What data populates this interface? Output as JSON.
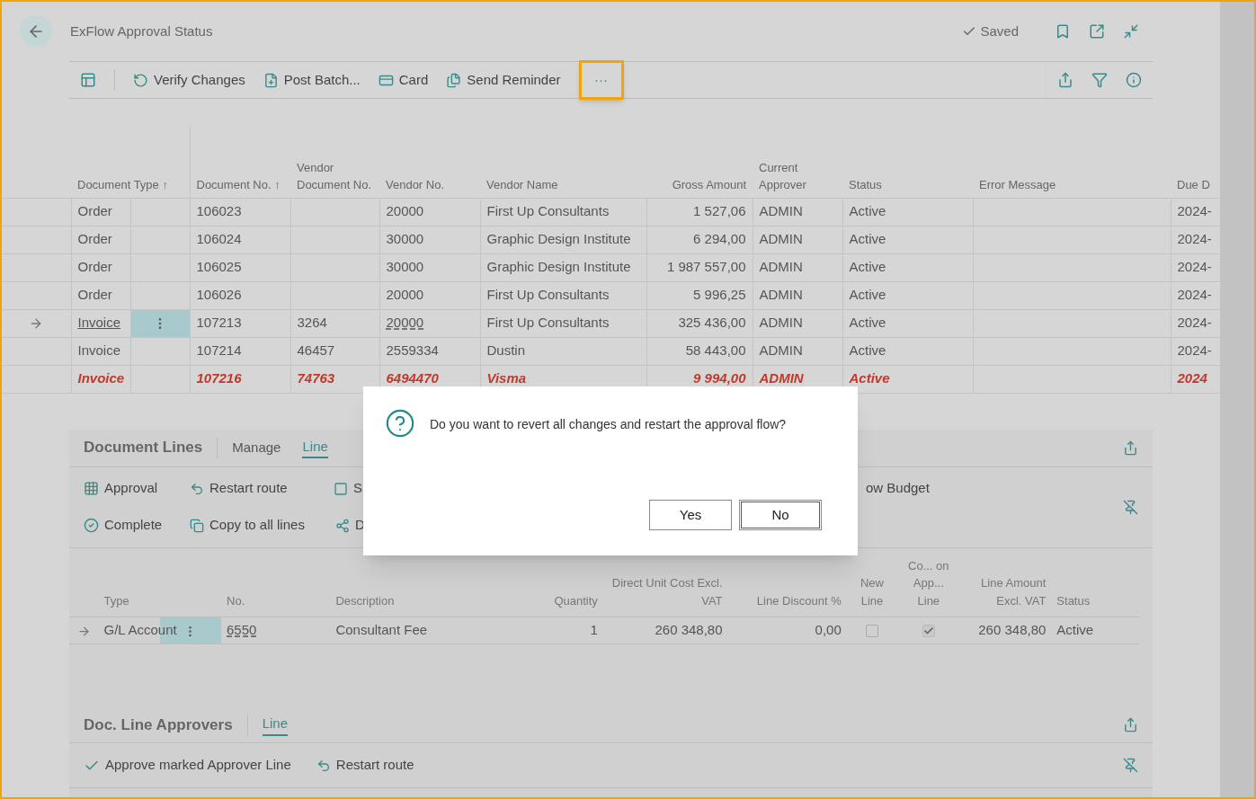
{
  "page": {
    "title": "ExFlow Approval Status",
    "save_status": "Saved"
  },
  "toolbar": {
    "actions": [
      {
        "kind": "verify",
        "label": "Verify Changes"
      },
      {
        "kind": "post",
        "label": "Post Batch..."
      },
      {
        "kind": "card",
        "label": "Card"
      },
      {
        "kind": "reminder",
        "label": "Send Reminder"
      }
    ],
    "more": {
      "label": "···",
      "highlighted": true
    }
  },
  "table": {
    "columns": [
      "Document Type ↑",
      "Document No. ↑",
      "Vendor Document No.",
      "Vendor No.",
      "Vendor Name",
      "Gross Amount",
      "Current Approver",
      "Status",
      "Error Message",
      "Due D"
    ],
    "rows": [
      {
        "selected": false,
        "highlight": false,
        "cells": [
          "Order",
          "106023",
          "",
          "20000",
          "First Up Consultants",
          "1 527,06",
          "ADMIN",
          "Active",
          "",
          "2024-"
        ]
      },
      {
        "selected": false,
        "highlight": false,
        "cells": [
          "Order",
          "106024",
          "",
          "30000",
          "Graphic Design Institute",
          "6 294,00",
          "ADMIN",
          "Active",
          "",
          "2024-"
        ]
      },
      {
        "selected": false,
        "highlight": false,
        "cells": [
          "Order",
          "106025",
          "",
          "30000",
          "Graphic Design Institute",
          "1 987 557,00",
          "ADMIN",
          "Active",
          "",
          "2024-"
        ]
      },
      {
        "selected": false,
        "highlight": false,
        "cells": [
          "Order",
          "106026",
          "",
          "20000",
          "First Up Consultants",
          "5 996,25",
          "ADMIN",
          "Active",
          "",
          "2024-"
        ]
      },
      {
        "selected": true,
        "highlight": false,
        "cells": [
          "Invoice",
          "107213",
          "3264",
          "20000",
          "First Up Consultants",
          "325 436,00",
          "ADMIN",
          "Active",
          "",
          "2024-"
        ]
      },
      {
        "selected": false,
        "highlight": false,
        "cells": [
          "Invoice",
          "107214",
          "46457",
          "2559334",
          "Dustin",
          "58 443,00",
          "ADMIN",
          "Active",
          "",
          "2024-"
        ]
      },
      {
        "selected": false,
        "highlight": true,
        "cells": [
          "Invoice",
          "107216",
          "74763",
          "6494470",
          "Visma",
          "9 994,00",
          "ADMIN",
          "Active",
          "",
          "2024"
        ]
      }
    ]
  },
  "document_lines": {
    "title": "Document Lines",
    "tabs": [
      {
        "label": "Manage",
        "selected": false
      },
      {
        "label": "Line",
        "selected": true
      }
    ],
    "actions_row1": [
      {
        "kind": "approval",
        "label": "Approval"
      },
      {
        "kind": "restart",
        "label": "Restart route"
      },
      {
        "kind": "page",
        "label": "S"
      },
      {
        "kind": "none",
        "label": "ow Budget"
      }
    ],
    "actions_row2": [
      {
        "kind": "complete",
        "label": "Complete"
      },
      {
        "kind": "copy",
        "label": "Copy to all lines"
      },
      {
        "kind": "split",
        "label": "D"
      }
    ],
    "columns": [
      "Type",
      "No.",
      "Description",
      "Quantity",
      "Direct Unit Cost Excl. VAT",
      "Line Discount %",
      "New Line",
      "Co... on App... Line",
      "Line Amount Excl. VAT",
      "Status"
    ],
    "rows": [
      {
        "selected": true,
        "type": "G/L Account",
        "no": "6550",
        "description": "Consultant Fee",
        "quantity": "1",
        "unit_cost": "260 348,80",
        "discount": "0,00",
        "new_line": false,
        "on_approval_line": true,
        "line_amount": "260 348,80",
        "status": "Active"
      }
    ]
  },
  "approvers": {
    "title": "Doc. Line Approvers",
    "tabs": [
      {
        "label": "Line",
        "selected": true
      }
    ],
    "actions": [
      {
        "kind": "check",
        "label": "Approve marked Approver Line"
      },
      {
        "kind": "restart",
        "label": "Restart route"
      }
    ]
  },
  "dialog": {
    "message": "Do you want to revert all changes and restart the approval flow?",
    "buttons": [
      {
        "label": "Yes",
        "default": false
      },
      {
        "label": "No",
        "default": true
      }
    ]
  }
}
